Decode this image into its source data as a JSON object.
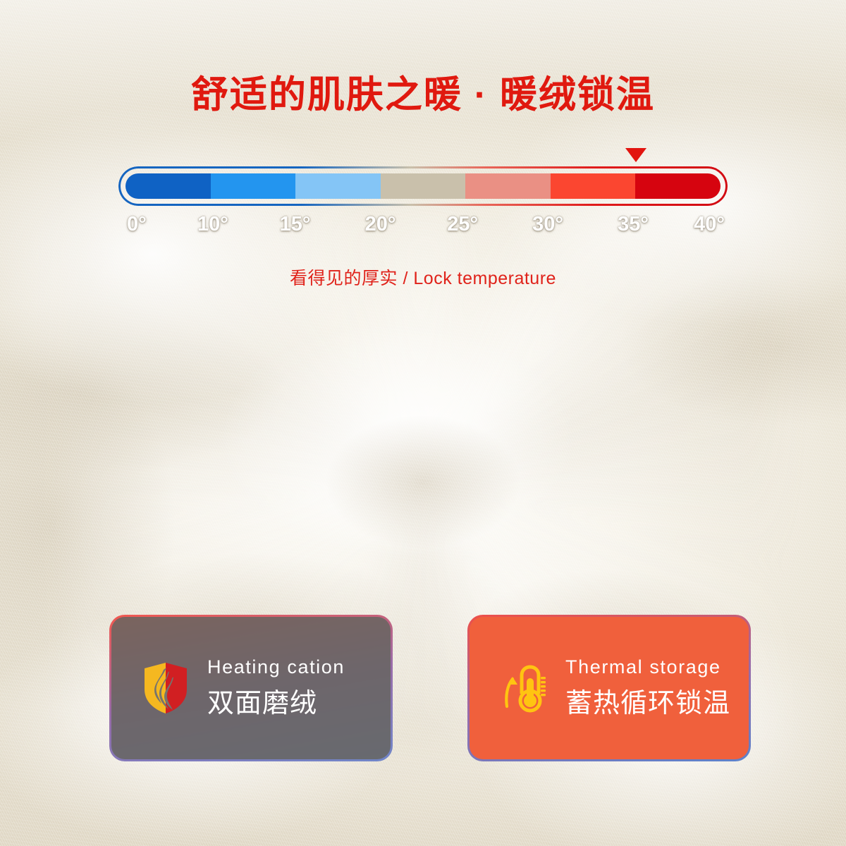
{
  "headline": {
    "text": "舒适的肌肤之暖 · 暖绒锁温",
    "color": "#e0190f"
  },
  "subtitle": {
    "text": "看得见的厚实 / Lock temperature",
    "color": "#e0221a"
  },
  "gauge": {
    "pointer": {
      "name": "current-temperature-pointer",
      "color": "#e2140f",
      "position_percent": 85,
      "value_label": "35°"
    },
    "ticks": [
      {
        "label": "0°",
        "position_percent": 3
      },
      {
        "label": "10°",
        "position_percent": 15.5
      },
      {
        "label": "15°",
        "position_percent": 29
      },
      {
        "label": "20°",
        "position_percent": 43
      },
      {
        "label": "25°",
        "position_percent": 56.5
      },
      {
        "label": "30°",
        "position_percent": 70.5
      },
      {
        "label": "35°",
        "position_percent": 84.5
      },
      {
        "label": "40°",
        "position_percent": 97
      }
    ],
    "segments": [
      {
        "name": "cold-deep",
        "color": "#0f62c4"
      },
      {
        "name": "cold-mid",
        "color": "#2395ef"
      },
      {
        "name": "cold-light",
        "color": "#84c5f6"
      },
      {
        "name": "neutral",
        "color": "#c9c0ab"
      },
      {
        "name": "warm-light",
        "color": "#ea9084"
      },
      {
        "name": "warm-mid",
        "color": "#fb4630"
      },
      {
        "name": "warm-hot",
        "color": "#d6040f"
      }
    ],
    "outline_gradient": {
      "start": "#1565c0",
      "middle": "#c9c0ab",
      "end": "#d20a12"
    }
  },
  "cards": [
    {
      "id": "heating-cation",
      "icon": "shield-flame-icon",
      "en_label": "Heating cation",
      "cn_label": "双面磨绒",
      "fill_color": "rgba(103,101,97,0.86)",
      "border_top_color": "#f2584f",
      "border_mid_color": "#9a6ba8",
      "border_bottom_color": "#6f86c9",
      "icon_colors": {
        "left": "#f5b820",
        "right": "#d11f22",
        "flame": "#76746e"
      }
    },
    {
      "id": "thermal-storage",
      "icon": "thermometer-arrow-icon",
      "en_label": "Thermal storage",
      "cn_label": "蓄热循环锁温",
      "fill_color": "#f0603c",
      "border_top_color": "#ee4f48",
      "border_mid_color": "#9a6ba8",
      "border_bottom_color": "#5d82cb",
      "icon_colors": {
        "main": "#ffc411",
        "shade": "#e8a600"
      }
    }
  ],
  "background": {
    "name": "fleece-fabric-photo",
    "base_color": "#f2efe6",
    "highlight_color": "#fdfcf8",
    "shadow_color": "#cdc2ac"
  }
}
